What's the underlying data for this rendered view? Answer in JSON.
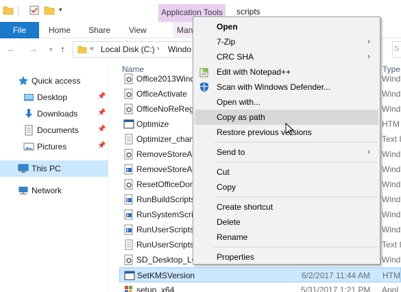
{
  "titlebar": {
    "context_tab": "Application Tools",
    "window_title": "scripts"
  },
  "ribbon": {
    "tabs": [
      "File",
      "Home",
      "Share",
      "View",
      "Man"
    ]
  },
  "address": {
    "overflow": "«",
    "segments": [
      "Local Disk (C:)",
      "Windo"
    ]
  },
  "navpane": {
    "items": [
      {
        "label": "Quick access",
        "icon": "star-icon",
        "pinned": false
      },
      {
        "label": "Desktop",
        "icon": "desktop-folder-icon",
        "pinned": true
      },
      {
        "label": "Downloads",
        "icon": "download-arrow-icon",
        "pinned": true
      },
      {
        "label": "Documents",
        "icon": "documents-icon",
        "pinned": true
      },
      {
        "label": "Pictures",
        "icon": "pictures-icon",
        "pinned": true
      },
      {
        "label": "This PC",
        "icon": "computer-icon",
        "pinned": false
      },
      {
        "label": "Network",
        "icon": "network-icon",
        "pinned": false
      }
    ],
    "selected": "This PC"
  },
  "filelist": {
    "columns": {
      "name": "Name",
      "type": "Type"
    },
    "rows": [
      {
        "name": "Office2013Wind",
        "date": "",
        "type": "Wind",
        "icon": "script-gear-icon"
      },
      {
        "name": "OfficeActivate",
        "date": "",
        "type": "Wind",
        "icon": "script-gear-icon"
      },
      {
        "name": "OfficeNoReReg",
        "date": "",
        "type": "Wind",
        "icon": "script-gear-icon"
      },
      {
        "name": "Optimize",
        "date": "",
        "type": "HTM",
        "icon": "hta-window-icon"
      },
      {
        "name": "Optimizer_chan",
        "date": "",
        "type": "Text I",
        "icon": "text-file-icon"
      },
      {
        "name": "RemoveStoreAp",
        "date": "",
        "type": "Wind",
        "icon": "script-gear-icon"
      },
      {
        "name": "RemoveStoreAp",
        "date": "",
        "type": "Wind",
        "icon": "powershell-icon"
      },
      {
        "name": "ResetOfficeDon",
        "date": "",
        "type": "Wind",
        "icon": "script-gear-icon"
      },
      {
        "name": "RunBuildScripts",
        "date": "",
        "type": "Wind",
        "icon": "powershell-icon"
      },
      {
        "name": "RunSystemScrip",
        "date": "",
        "type": "Wind",
        "icon": "powershell-icon"
      },
      {
        "name": "RunUserScripts",
        "date": "",
        "type": "Wind",
        "icon": "powershell-icon"
      },
      {
        "name": "RunUserScripts",
        "date": "",
        "type": "Text I",
        "icon": "text-file-icon"
      },
      {
        "name": "SD_Desktop_LO",
        "date": "",
        "type": "Wind",
        "icon": "script-gear-icon"
      },
      {
        "name": "SetKMSVersion",
        "date": "6/2/2017 11:44 AM",
        "type": "HTM",
        "icon": "hta-window-icon",
        "selected": true
      },
      {
        "name": "setup_x64",
        "date": "5/31/2017 1:21 PM",
        "type": "Appl",
        "icon": "installer-icon"
      }
    ]
  },
  "contextmenu": {
    "items": [
      {
        "label": "Open",
        "bold": true
      },
      {
        "label": "7-Zip",
        "submenu": true
      },
      {
        "label": "CRC SHA",
        "submenu": true
      },
      {
        "label": "Edit with Notepad++",
        "icon": "notepadpp-icon"
      },
      {
        "label": "Scan with Windows Defender...",
        "icon": "defender-shield-icon"
      },
      {
        "label": "Open with..."
      },
      {
        "label": "Copy as path",
        "hover": true
      },
      {
        "label": "Restore previous versions"
      },
      {
        "label": "Send to",
        "submenu": true
      },
      {
        "label": "Cut"
      },
      {
        "label": "Copy"
      },
      {
        "label": "Create shortcut"
      },
      {
        "label": "Delete"
      },
      {
        "label": "Rename"
      },
      {
        "label": "Properties"
      }
    ]
  },
  "colors": {
    "accent": "#1979ca",
    "context_tab": "#e8cfef",
    "selection": "#cce8ff",
    "menu_bg": "#f2f2f2",
    "menu_hover": "#d8d8d8"
  }
}
